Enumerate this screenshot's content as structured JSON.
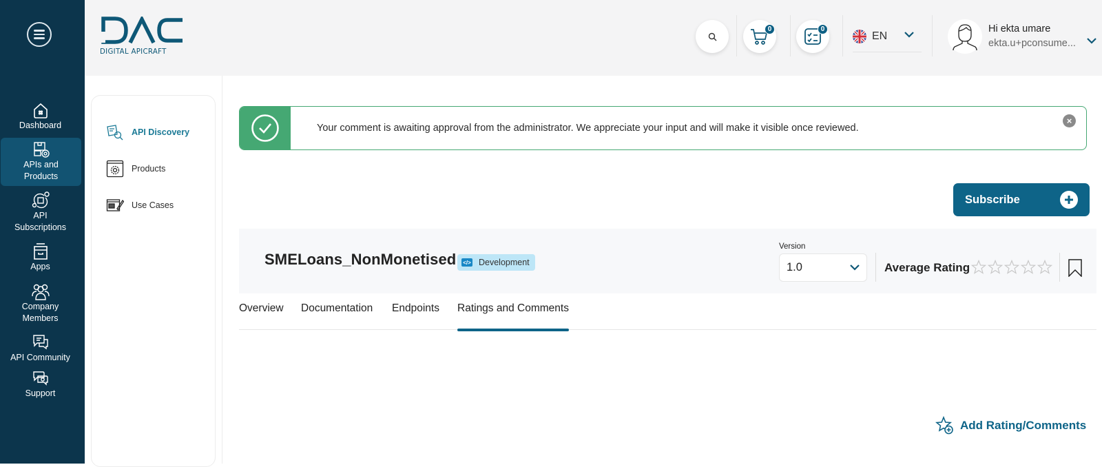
{
  "rail": {
    "menu_icon": "hamburger-menu-icon",
    "items": [
      {
        "label": "Dashboard",
        "icon": "home-icon",
        "active": false
      },
      {
        "label": "APIs and Products",
        "label_lines": [
          "APIs and",
          "Products"
        ],
        "icon": "api-products-icon",
        "active": true
      },
      {
        "label": "API Subscriptions",
        "label_lines": [
          "API",
          "Subscriptions"
        ],
        "icon": "subscriptions-icon",
        "active": false
      },
      {
        "label": "Apps",
        "icon": "archive-box-icon",
        "active": false
      },
      {
        "label": "Company Members",
        "label_lines": [
          "Company",
          "Members"
        ],
        "icon": "users-group-icon",
        "active": false
      },
      {
        "label": "API Community",
        "icon": "chat-bubbles-icon",
        "active": false
      },
      {
        "label": "Support",
        "icon": "support-chat-icon",
        "active": false
      }
    ]
  },
  "header": {
    "logo_text": "DAC",
    "logo_subtitle": "DIGITAL APICRAFT",
    "search_icon": "search-icon",
    "cart_count": "0",
    "tasks_count": "0",
    "language": "EN",
    "language_flag": "uk-flag-icon",
    "user_greeting": "Hi ekta umare",
    "user_email": "ekta.u+pconsume..."
  },
  "subnav": {
    "items": [
      {
        "label": "API Discovery",
        "icon": "api-discovery-icon",
        "active": true
      },
      {
        "label": "Products",
        "icon": "products-gear-icon",
        "active": false
      },
      {
        "label": "Use Cases",
        "icon": "use-cases-icon",
        "active": false
      }
    ]
  },
  "alert": {
    "type": "success",
    "message": "Your comment is awaiting approval from the administrator. We appreciate your input and will make it visible once reviewed.",
    "close_icon": "close-icon"
  },
  "subscribe_label": "Subscribe",
  "api": {
    "name": "SMELoans_NonMonetised",
    "environment": "Development",
    "version_label": "Version",
    "version_value": "1.0",
    "average_rating_label": "Average Rating",
    "rating": 0,
    "rating_max": 5
  },
  "tabs": [
    {
      "label": "Overview",
      "active": false
    },
    {
      "label": "Documentation",
      "active": false
    },
    {
      "label": "Endpoints",
      "active": false
    },
    {
      "label": "Ratings and Comments",
      "active": true
    }
  ],
  "add_rating_label": "Add Rating/Comments",
  "colors": {
    "rail_bg": "#0c354c",
    "rail_active": "#125372",
    "primary": "#0e6488",
    "success": "#45a873",
    "env_badge_bg": "#bde6f7",
    "discovery_active": "#1b7a96"
  }
}
